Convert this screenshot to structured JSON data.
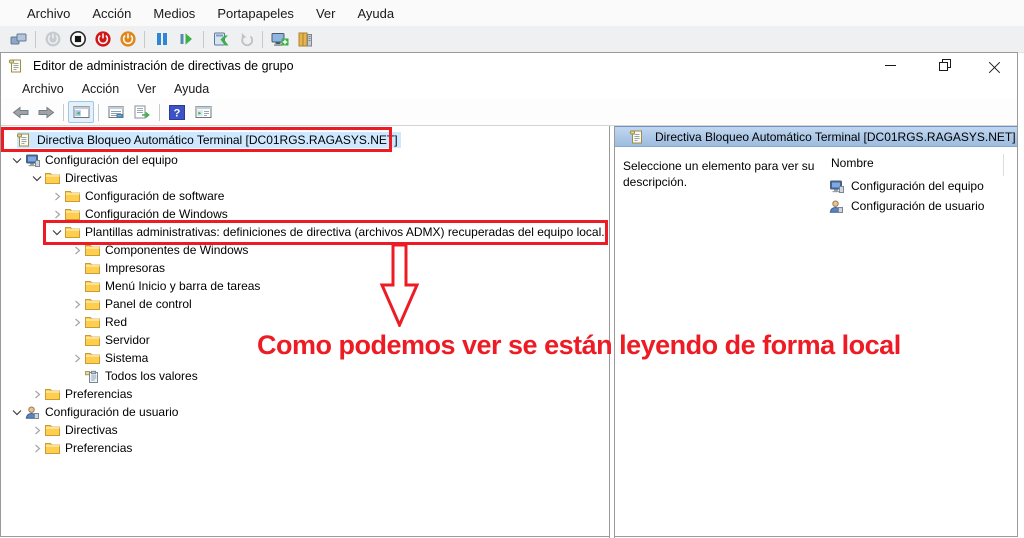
{
  "vm_window": {
    "menu": [
      "Archivo",
      "Acción",
      "Medios",
      "Portapapeles",
      "Ver",
      "Ayuda"
    ],
    "toolbar": [
      {
        "icon": "ctrl-alt-del-icon"
      },
      {
        "icon": "separator"
      },
      {
        "icon": "start-icon",
        "disabled": true
      },
      {
        "icon": "stop-icon"
      },
      {
        "icon": "turn-off-icon"
      },
      {
        "icon": "shutdown-icon"
      },
      {
        "icon": "separator"
      },
      {
        "icon": "pause-icon"
      },
      {
        "icon": "resume-icon"
      },
      {
        "icon": "separator"
      },
      {
        "icon": "checkpoint-icon"
      },
      {
        "icon": "revert-icon",
        "disabled": true
      },
      {
        "icon": "separator"
      },
      {
        "icon": "enhanced-session-icon"
      },
      {
        "icon": "server-icon"
      }
    ]
  },
  "editor_window": {
    "title": "Editor de administración de directivas de grupo",
    "menu": [
      "Archivo",
      "Acción",
      "Ver",
      "Ayuda"
    ],
    "window_controls": [
      "minimize",
      "restore",
      "close"
    ],
    "toolbar": [
      {
        "icon": "back-icon"
      },
      {
        "icon": "forward-icon"
      },
      {
        "icon": "separator"
      },
      {
        "icon": "console-tree-icon",
        "active": true
      },
      {
        "icon": "separator"
      },
      {
        "icon": "properties-icon"
      },
      {
        "icon": "export-list-icon"
      },
      {
        "icon": "separator"
      },
      {
        "icon": "help-icon"
      },
      {
        "icon": "show-action-pane-icon"
      }
    ]
  },
  "tree": {
    "items": [
      {
        "label": "Directiva Bloqueo Automático Terminal [DC01RGS.RAGASYS.NET]",
        "level": 0,
        "icon": "gpo-icon",
        "expander": "none",
        "selected": true
      },
      {
        "label": "Configuración del equipo",
        "level": 1,
        "icon": "computer-icon",
        "expander": "expanded"
      },
      {
        "label": "Directivas",
        "level": 2,
        "icon": "folder-icon",
        "expander": "expanded"
      },
      {
        "label": "Configuración de software",
        "level": 3,
        "icon": "folder-icon",
        "expander": "collapsed"
      },
      {
        "label": "Configuración de Windows",
        "level": 3,
        "icon": "folder-icon",
        "expander": "collapsed"
      },
      {
        "label": "Plantillas administrativas: definiciones de directiva (archivos ADMX) recuperadas del equipo local.",
        "level": 3,
        "icon": "folder-icon",
        "expander": "expanded"
      },
      {
        "label": "Componentes de Windows",
        "level": 4,
        "icon": "folder-icon",
        "expander": "collapsed"
      },
      {
        "label": "Impresoras",
        "level": 4,
        "icon": "folder-icon",
        "expander": "none"
      },
      {
        "label": "Menú Inicio y barra de tareas",
        "level": 4,
        "icon": "folder-icon",
        "expander": "none"
      },
      {
        "label": "Panel de control",
        "level": 4,
        "icon": "folder-icon",
        "expander": "collapsed"
      },
      {
        "label": "Red",
        "level": 4,
        "icon": "folder-icon",
        "expander": "collapsed"
      },
      {
        "label": "Servidor",
        "level": 4,
        "icon": "folder-icon",
        "expander": "none"
      },
      {
        "label": "Sistema",
        "level": 4,
        "icon": "folder-icon",
        "expander": "collapsed"
      },
      {
        "label": "Todos los valores",
        "level": 4,
        "icon": "all-values-icon",
        "expander": "none"
      },
      {
        "label": "Preferencias",
        "level": 2,
        "icon": "folder-icon",
        "expander": "collapsed"
      },
      {
        "label": "Configuración de usuario",
        "level": 1,
        "icon": "user-icon",
        "expander": "expanded"
      },
      {
        "label": "Directivas",
        "level": 2,
        "icon": "folder-icon",
        "expander": "collapsed"
      },
      {
        "label": "Preferencias",
        "level": 2,
        "icon": "folder-icon",
        "expander": "collapsed"
      }
    ]
  },
  "right_pane": {
    "header": "Directiva Bloqueo Automático Terminal [DC01RGS.RAGASYS.NET]",
    "description": "Seleccione un elemento para ver su descripción.",
    "column_header": "Nombre",
    "items": [
      {
        "label": "Configuración del equipo",
        "icon": "computer-icon"
      },
      {
        "label": "Configuración de usuario",
        "icon": "user-icon"
      }
    ]
  },
  "annotation": {
    "text": "Como podemos ver se están leyendo de forma local",
    "color": "#ed1c24"
  }
}
